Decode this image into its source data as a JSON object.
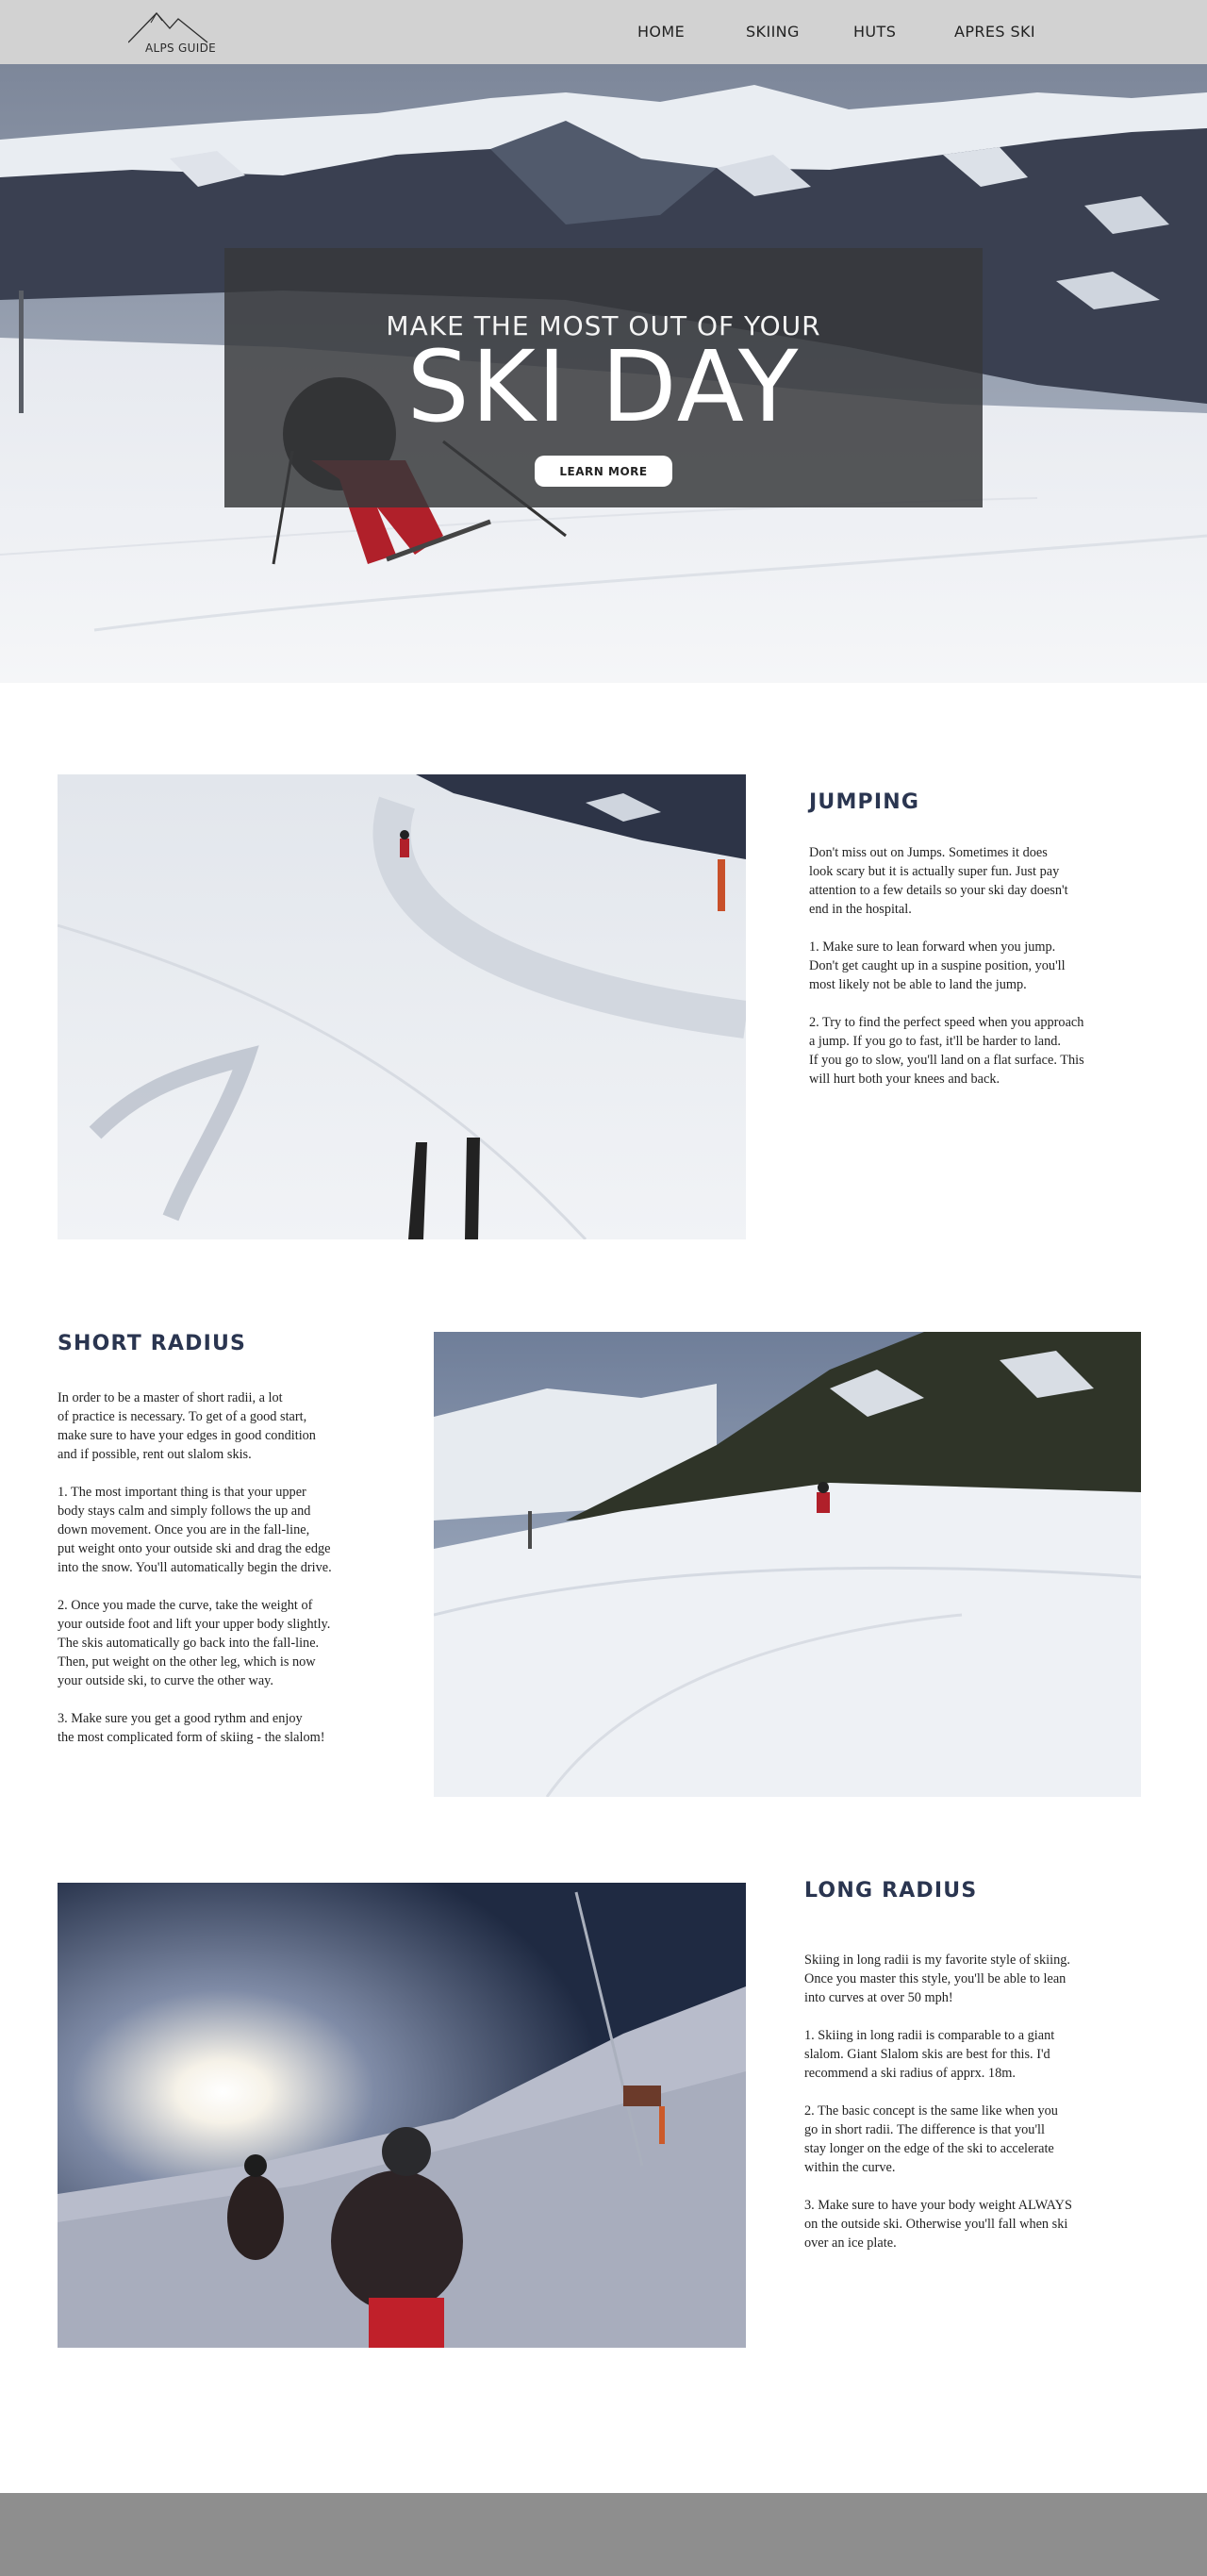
{
  "header": {
    "logo_text": "ALPS GUIDE",
    "nav": [
      "HOME",
      "SKIING",
      "HUTS",
      "APRES SKI"
    ]
  },
  "hero": {
    "subtitle": "MAKE THE MOST OUT OF YOUR",
    "title": "SKI DAY",
    "button_label": "LEARN MORE"
  },
  "sections": {
    "jumping": {
      "heading": "JUMPING",
      "paragraphs": [
        "Don't miss out on Jumps. Sometimes it does\nlook scary but it is actually super fun. Just pay\nattention to a few details so your ski day doesn't\nend in the hospital.",
        "1. Make sure to lean forward when you jump.\nDon't get caught up in a suspine position, you'll\nmost likely not be able to land the jump.",
        "2. Try to find the perfect speed when you approach\na jump. If you go to fast, it'll be harder to land.\nIf you go to slow, you'll land on a flat surface. This\nwill hurt both your knees and back."
      ]
    },
    "short_radius": {
      "heading": "SHORT RADIUS",
      "paragraphs": [
        "In order to be a master of short radii, a lot\nof practice is necessary. To get of a good start,\nmake sure to have your edges in good condition\nand if possible, rent out slalom skis.",
        "1. The most important thing is that your upper\nbody stays calm and simply follows the up and\ndown movement. Once you are in the fall-line,\nput weight onto your outside ski and drag the edge\ninto the snow. You'll automatically begin the drive.",
        "2. Once you made the curve, take the weight of\nyour outside foot and lift your upper body slightly.\nThe skis automatically go back into the fall-line.\nThen, put weight on the other leg, which is now\nyour outside ski, to curve the other way.",
        "3. Make sure you get a good rythm and enjoy\nthe most complicated form of skiing - the slalom!"
      ]
    },
    "long_radius": {
      "heading": "LONG RADIUS",
      "paragraphs": [
        "Skiing in long radii is my favorite style of skiing.\nOnce you master this style, you'll be able to lean\ninto curves at over 50 mph!",
        "1. Skiing in long radii is comparable to a giant\nslalom. Giant Slalom skis are best for this. I'd\nrecommend a ski radius of apprx. 18m.",
        "2. The basic concept is the same like when you\ngo in short radii. The difference is that you'll\nstay longer on the edge of the ski to accelerate\nwithin the curve.",
        "3. Make sure to have your body weight ALWAYS\non the outside ski. Otherwise you'll fall when ski\nover an ice plate."
      ]
    }
  },
  "colors": {
    "header_bg": "#d2d2d2",
    "heading": "#2a3550",
    "overlay": "#37383a",
    "footer_bg": "#8e8e8e"
  },
  "icons": [
    "mountain-logo-icon"
  ]
}
